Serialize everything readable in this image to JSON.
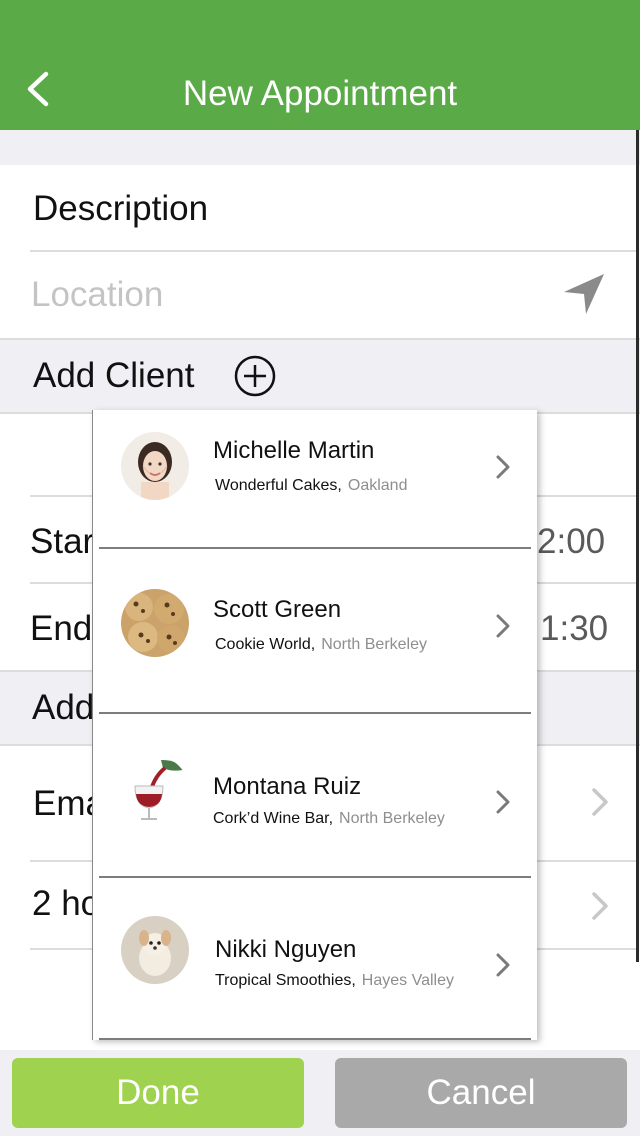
{
  "header": {
    "title": "New Appointment",
    "background": "#5aab47"
  },
  "form": {
    "description": "Description",
    "location_placeholder": "Location",
    "add_client_label": "Add Client",
    "start_label_visible": "Star",
    "start_time_visible": "2:00",
    "end_label_visible": "End",
    "end_time_visible": "1:30",
    "add_label_visible": "Add",
    "email_label_visible": "Ema",
    "reminder_label_visible": "2 ho"
  },
  "client_list": [
    {
      "name": "Michelle Martin",
      "company": "Wonderful Cakes,",
      "area": "Oakland",
      "avatar_icon": "woman-portrait-avatar"
    },
    {
      "name": "Scott Green",
      "company": "Cookie World,",
      "area": "North Berkeley",
      "avatar_icon": "cookies-avatar"
    },
    {
      "name": "Montana Ruiz",
      "company": "Cork’d Wine Bar,",
      "area": "North Berkeley",
      "avatar_icon": "wine-glass-avatar"
    },
    {
      "name": "Nikki Nguyen",
      "company": "Tropical Smoothies,",
      "area": "Hayes Valley",
      "avatar_icon": "puppy-avatar"
    }
  ],
  "buttons": {
    "done": "Done",
    "cancel": "Cancel",
    "done_color": "#9ed24f",
    "cancel_color": "#a9a9a9"
  }
}
